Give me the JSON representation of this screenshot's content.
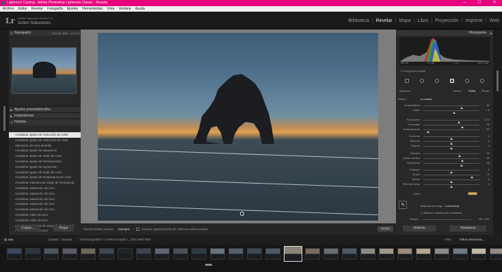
{
  "titlebar": {
    "title": "Lightroom Catalog - Adobe Photoshop Lightroom Classic - Revelar",
    "min": "—",
    "max": "☐",
    "close": "✕"
  },
  "menu": [
    "Archivo",
    "Editar",
    "Revelar",
    "Fotografía",
    "Ajustes",
    "Herramientas",
    "Vista",
    "Ventana",
    "Ayuda"
  ],
  "header": {
    "logo": "Lr",
    "plate_small": "Adobe Lightroom Classic CC",
    "plate_big": "Action Soluciones"
  },
  "modules": [
    "Biblioteca",
    "Revelar",
    "Mapa",
    "Libro",
    "Proyección",
    "Imprimir",
    "Web"
  ],
  "active_module": "Revelar",
  "left_panel": {
    "navigator": {
      "title": "Navegador",
      "zoom": [
        "ENCAJ.",
        "RELL.",
        "1:1",
        "1:4"
      ]
    },
    "presets": "Ajustes preestablecidos",
    "snapshots": "Instantáneas",
    "history": "Historia",
    "history_items": [
      {
        "label": "Actualizar ajuste de reducción de ruido",
        "sel": true
      },
      {
        "label": "Actualizar ajuste de reducción de ruido"
      },
      {
        "label": "Alteración de tono amarillo",
        "val": "47"
      },
      {
        "label": "Actualizar ajuste de saturación"
      },
      {
        "label": "Actualizar ajuste de matiz de color"
      },
      {
        "label": "Actualizar ajuste de iluminaciones"
      },
      {
        "label": "Actualizar ajuste de exposición"
      },
      {
        "label": "Actualizar ajuste de matiz de color"
      },
      {
        "label": "Actualizar ajuste de temperatura de color"
      },
      {
        "label": "Actualizar máscara de rango de luminancia"
      },
      {
        "label": "Actualizar saturación de tono"
      },
      {
        "label": "Actualizar saturación de tono"
      },
      {
        "label": "Actualizar saturación de tono"
      },
      {
        "label": "Actualizar saturación de tono"
      },
      {
        "label": "Actualizar saturación de tono"
      },
      {
        "label": "Actualizar matiz de tono"
      },
      {
        "label": "Actualizar matiz de tono"
      },
      {
        "label": "Actualizar máscara de rango de luminancia"
      },
      {
        "label": "Actualizar matiz de tono"
      },
      {
        "label": "Actualizar saturación de tono"
      }
    ],
    "copy_btn": "Copiar...",
    "paste_btn": "Pegar"
  },
  "toolbar": {
    "show_pins": "Mostrar Editar puntos :",
    "show_pins_val": "Siempre",
    "overlay": "Mostrar superposición de máscara seleccionada",
    "done": "Hecho"
  },
  "right_panel": {
    "histogram": "Histograma",
    "hist_info": [
      "ISO 50",
      "17 mm",
      "f / 12",
      "240,0 seg"
    ],
    "original_photo": "Fotografía original",
    "mask_label": "Máscara :",
    "mask_new": "Nuevo",
    "mask_edit": "Editar",
    "mask_brush": "Pincel",
    "effect_label": "Efecto :",
    "effect_val": "A medida",
    "sliders": [
      {
        "label": "Temperatura",
        "val": "31",
        "pos": 0.68
      },
      {
        "label": "Matiz",
        "val": "+ 6",
        "pos": 0.55
      },
      {
        "label": "Exposición",
        "val": "0,72",
        "pos": 0.63
      },
      {
        "label": "Contraste",
        "val": "42",
        "pos": 0.7
      },
      {
        "label": "Iluminaciones",
        "val": "- 87",
        "pos": 0.08
      },
      {
        "label": "Sombras",
        "val": "0",
        "pos": 0.5
      },
      {
        "label": "Blancos",
        "val": "0",
        "pos": 0.5
      },
      {
        "label": "Negros",
        "val": "0",
        "pos": 0.5
      },
      {
        "label": "Claridad",
        "val": "30",
        "pos": 0.65
      },
      {
        "label": "Quitar neblina",
        "val": "42",
        "pos": 0.7
      },
      {
        "label": "Saturación",
        "val": "36",
        "pos": 0.68
      },
      {
        "label": "Enfoque",
        "val": "0",
        "pos": 0.5
      },
      {
        "label": "Ruido",
        "val": "75",
        "pos": 0.87
      },
      {
        "label": "Muaré",
        "val": "0",
        "pos": 0.5
      },
      {
        "label": "Eliminar halos",
        "val": "0",
        "pos": 0.5
      },
      {
        "label": "Color",
        "val": "",
        "pos": -1
      }
    ],
    "range_mask": "Máscara de rango :",
    "range_mask_val": "Luminancia",
    "show_lum_mask": "Mostrar máscara de luminancia",
    "range_label": "Rango",
    "range_val": "52 / 100",
    "prev_btn": "Anterior",
    "reset_btn": "Restaurar"
  },
  "filmbar": {
    "path": "Carpeta : Islandia",
    "count": "3155 fotografías / 1 seleccionadas / _DSC3960.NEF",
    "filter": "Filtro :",
    "filter_val": "Filtros desactiva..."
  },
  "swatch_color": "#e0a64c"
}
